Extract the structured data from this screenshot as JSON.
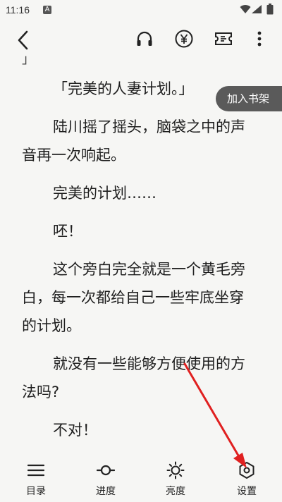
{
  "status_bar": {
    "time": "11:16",
    "notification_badge": "A"
  },
  "toolbar": {
    "back_icon": "back-chevron-icon",
    "headphone_icon": "headphone-icon",
    "yen_icon": "yen-icon",
    "ticket_icon": "ticket-icon",
    "more_icon": "more-vertical-icon"
  },
  "reader": {
    "prev_fragment": "」",
    "paragraphs": [
      "「完美的人妻计划。」",
      "陆川摇了摇头，脑袋之中的声",
      "音再一次响起。",
      "完美的计划……",
      "呸！",
      "这个旁白完全就是一个黄毛旁",
      "白，每一次都给自己一些牢底坐穿",
      "的计划。",
      "就没有一些能够方便使用的方",
      "法吗?",
      "不对！"
    ]
  },
  "bookmark_button": "加入书架",
  "bottom_nav": [
    {
      "label": "目录",
      "icon": "menu-list-icon"
    },
    {
      "label": "进度",
      "icon": "progress-slider-icon"
    },
    {
      "label": "亮度",
      "icon": "brightness-sun-icon"
    },
    {
      "label": "设置",
      "icon": "settings-hexagon-icon"
    }
  ],
  "colors": {
    "background": "#f6f6f4",
    "text": "#1e1e1e",
    "bookmark_bg": "#5a5a5a",
    "annotation_arrow": "#e02020"
  }
}
